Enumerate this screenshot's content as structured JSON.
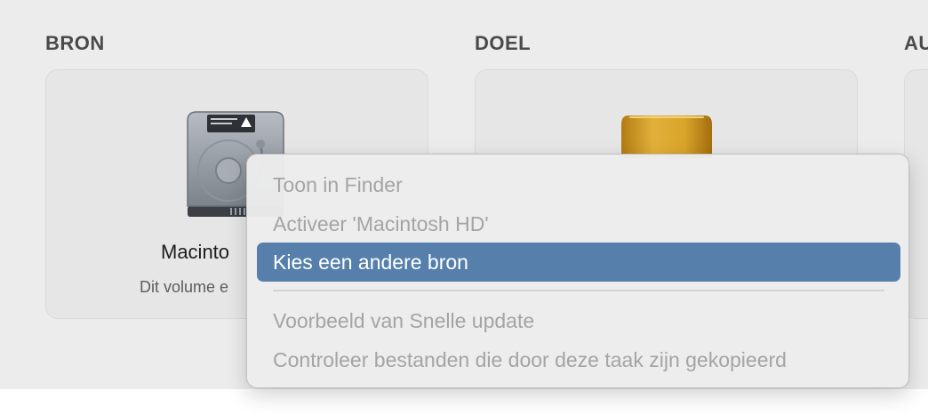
{
  "sections": {
    "source_heading": "BRON",
    "target_heading": "DOEL",
    "third_heading": "AU"
  },
  "source_card": {
    "title": "Macinto",
    "subtitle": "Dit volume e",
    "icon": "internal-hard-drive-icon"
  },
  "target_card": {
    "icon": "external-gold-drive-icon"
  },
  "context_menu": {
    "items": [
      {
        "label": "Toon in Finder",
        "enabled": false
      },
      {
        "label": "Activeer 'Macintosh HD'",
        "enabled": false
      },
      {
        "label": "Kies een andere bron",
        "enabled": true,
        "highlighted": true
      },
      {
        "label": "Voorbeeld van Snelle update",
        "enabled": false
      },
      {
        "label": "Controleer bestanden die door deze taak zijn gekopieerd",
        "enabled": false
      }
    ]
  },
  "colors": {
    "highlight": "#5680ab",
    "disabled_text": "#a4a4a4",
    "window_background": "#ececec",
    "drive_gold": "#d9a429"
  }
}
